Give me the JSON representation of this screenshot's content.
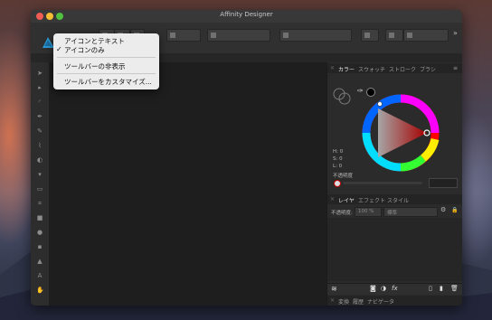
{
  "window": {
    "title": "Affinity Designer"
  },
  "menu": {
    "items": [
      {
        "label": "アイコンとテキスト",
        "checked": false
      },
      {
        "label": "アイコンのみ",
        "checked": true
      },
      {
        "label": "ツールバーの非表示",
        "checked": false
      },
      {
        "label": "ツールバーをカスタマイズ...",
        "checked": false
      }
    ],
    "check_mark": "✓"
  },
  "color_panel": {
    "tabs": [
      "カラー",
      "スウォッチ",
      "ストローク",
      "ブラシ"
    ],
    "active_tab": "カラー",
    "h": "H: 0",
    "s": "S: 0",
    "l": "L: 0",
    "opacity_label": "不透明度"
  },
  "layers_panel": {
    "tabs": [
      "レイヤ",
      "エフェクト",
      "スタイル"
    ],
    "active_tab": "レイヤ",
    "opacity_label": "不透明度:",
    "opacity_value": "100 %",
    "blend_mode": "標準",
    "fx_label": "fx"
  },
  "bottom_panel": {
    "tabs": [
      "変換",
      "履歴",
      "ナビゲータ"
    ]
  },
  "colors": {
    "accent": "#2d9ad8",
    "menu_bg": "#ececec",
    "canvas": "#1e1e1e"
  }
}
